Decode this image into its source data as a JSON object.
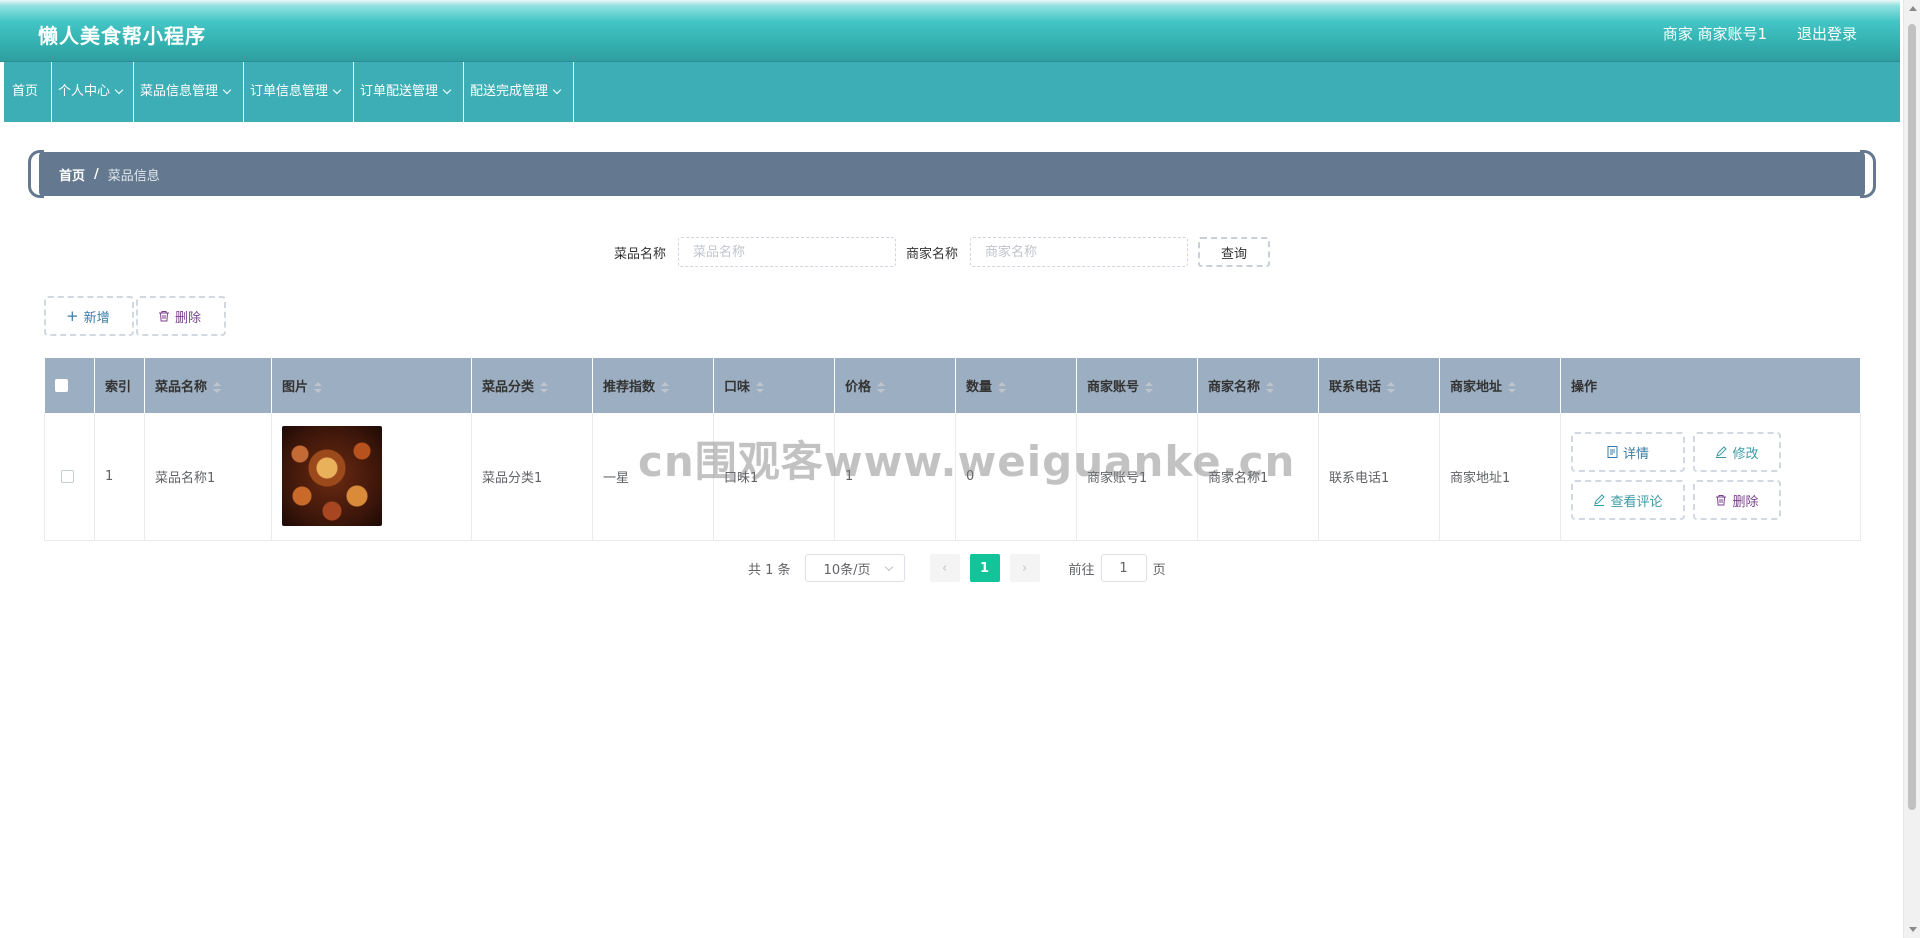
{
  "header": {
    "title": "懒人美食帮小程序",
    "user": "商家 商家账号1",
    "logout": "退出登录"
  },
  "nav": {
    "items": [
      {
        "label": "首页"
      },
      {
        "label": "个人中心"
      },
      {
        "label": "菜品信息管理"
      },
      {
        "label": "订单信息管理"
      },
      {
        "label": "订单配送管理"
      },
      {
        "label": "配送完成管理"
      }
    ]
  },
  "breadcrumb": {
    "home": "首页",
    "separator": "/",
    "current": "菜品信息"
  },
  "search": {
    "name_label": "菜品名称",
    "name_placeholder": "菜品名称",
    "merchant_label": "商家名称",
    "merchant_placeholder": "商家名称",
    "button": "查询"
  },
  "actions": {
    "add": "新增",
    "delete": "删除"
  },
  "table": {
    "headers": [
      "索引",
      "菜品名称",
      "图片",
      "菜品分类",
      "推荐指数",
      "口味",
      "价格",
      "数量",
      "商家账号",
      "商家名称",
      "联系电话",
      "商家地址",
      "操作"
    ],
    "rows": [
      {
        "index": "1",
        "name": "菜品名称1",
        "category": "菜品分类1",
        "rating": "一星",
        "taste": "口味1",
        "price": "1",
        "quantity": "0",
        "merchant_account": "商家账号1",
        "merchant_name": "商家名称1",
        "phone": "联系电话1",
        "address": "商家地址1",
        "ops": {
          "detail": "详情",
          "edit": "修改",
          "comment": "查看评论",
          "delete": "删除"
        }
      }
    ]
  },
  "pager": {
    "total": "共 1 条",
    "page_size": "10条/页",
    "prev": "‹",
    "current": "1",
    "next": "›",
    "goto_prefix": "前往",
    "goto_value": "1",
    "goto_suffix": "页"
  },
  "watermark": "cn围观客www.weiguanke.cn",
  "colors": {
    "header": "#3eaeb6",
    "breadcrumb": "#64798f",
    "table_header": "#9caec1",
    "pager_active": "#13c39a"
  }
}
